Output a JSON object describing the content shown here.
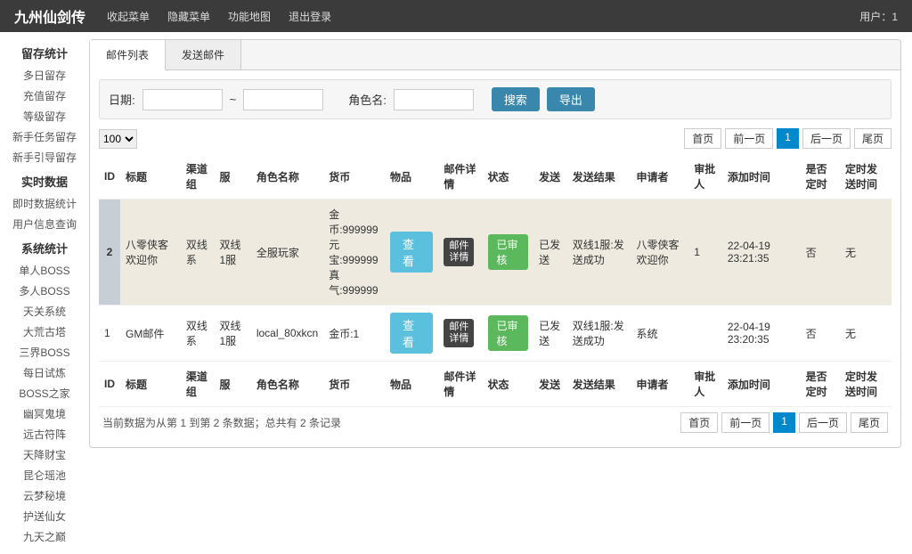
{
  "topbar": {
    "brand": "九州仙剑传",
    "nav": [
      "收起菜单",
      "隐藏菜单",
      "功能地图",
      "退出登录"
    ],
    "user_label": "用户：",
    "user_value": "1"
  },
  "sidebar": [
    {
      "title": "留存统计",
      "items": [
        "多日留存",
        "充值留存",
        "等级留存",
        "新手任务留存",
        "新手引导留存"
      ]
    },
    {
      "title": "实时数据",
      "items": [
        "即时数据统计",
        "用户信息查询"
      ]
    },
    {
      "title": "系统统计",
      "items": [
        "单人BOSS",
        "多人BOSS",
        "天关系统",
        "大荒古塔",
        "三界BOSS",
        "每日试炼",
        "BOSS之家",
        "幽冥鬼境",
        "远古符阵",
        "天降财宝",
        "昆仑瑶池",
        "云梦秘境",
        "护送仙女",
        "九天之巅"
      ]
    }
  ],
  "tabs": {
    "list": "邮件列表",
    "send": "发送邮件"
  },
  "filter": {
    "date_label": "日期:",
    "tilde": "~",
    "role_label": "角色名:",
    "search": "搜索",
    "export": "导出"
  },
  "page_size": "100",
  "pager": {
    "first": "首页",
    "prev": "前一页",
    "num": "1",
    "next": "后一页",
    "last": "尾页"
  },
  "columns": [
    "ID",
    "标题",
    "渠道组",
    "服",
    "角色名称",
    "货币",
    "物品",
    "邮件详情",
    "状态",
    "发送",
    "发送结果",
    "申请者",
    "审批人",
    "添加时间",
    "是否定时",
    "定时发送时间"
  ],
  "rows": [
    {
      "id": "2",
      "title": "八零侠客欢迎你",
      "channel": "双线系",
      "server": "双线1服",
      "role": "全服玩家",
      "currency": "金币:999999 元宝:999999 真气:999999",
      "item_btn": "查看",
      "detail_btn": "邮件详情",
      "status_btn": "已审核",
      "send": "已发送",
      "send_result": "双线1服:发送成功",
      "applicant": "八零侠客欢迎你",
      "approver": "1",
      "add_time": "22-04-19 23:21:35",
      "scheduled": "否",
      "schedule_time": "无"
    },
    {
      "id": "1",
      "title": "GM邮件",
      "channel": "双线系",
      "server": "双线1服",
      "role": "local_80xkcn",
      "currency": "金币:1",
      "item_btn": "查看",
      "detail_btn": "邮件详情",
      "status_btn": "已审核",
      "send": "已发送",
      "send_result": "双线1服:发送成功",
      "applicant": "系统",
      "approver": "",
      "add_time": "22-04-19 23:20:35",
      "scheduled": "否",
      "schedule_time": "无"
    }
  ],
  "footer_info": "当前数据为从第 1 到第 2 条数据；总共有 2 条记录"
}
